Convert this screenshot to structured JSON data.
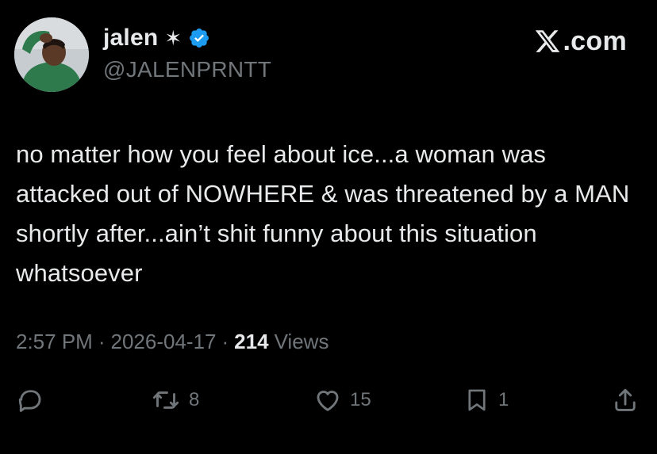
{
  "author": {
    "display_name": "jalen",
    "decoration": "✶",
    "verified": true,
    "handle": "@JALENPRNTT",
    "avatar": "profile-photo"
  },
  "brand": {
    "suffix": ".com"
  },
  "tweet": {
    "text": "no matter how you feel about ice...a woman was attacked out of NOWHERE & was threatened by a MAN shortly after...ain’t shit funny about this situation whatsoever"
  },
  "meta": {
    "time": "2:57 PM",
    "date": "2026-04-17",
    "views_count": "214",
    "views_label": "Views",
    "separator": "·"
  },
  "actions": {
    "reply": {
      "icon": "reply-icon",
      "count": ""
    },
    "repost": {
      "icon": "repost-icon",
      "count": "8"
    },
    "like": {
      "icon": "heart-icon",
      "count": "15"
    },
    "bookmark": {
      "icon": "bookmark-icon",
      "count": "1"
    },
    "share": {
      "icon": "share-icon",
      "count": ""
    }
  },
  "colors": {
    "background": "#000000",
    "text": "#e7e9ea",
    "secondary": "#71767b",
    "verified": "#1d9bf0"
  }
}
